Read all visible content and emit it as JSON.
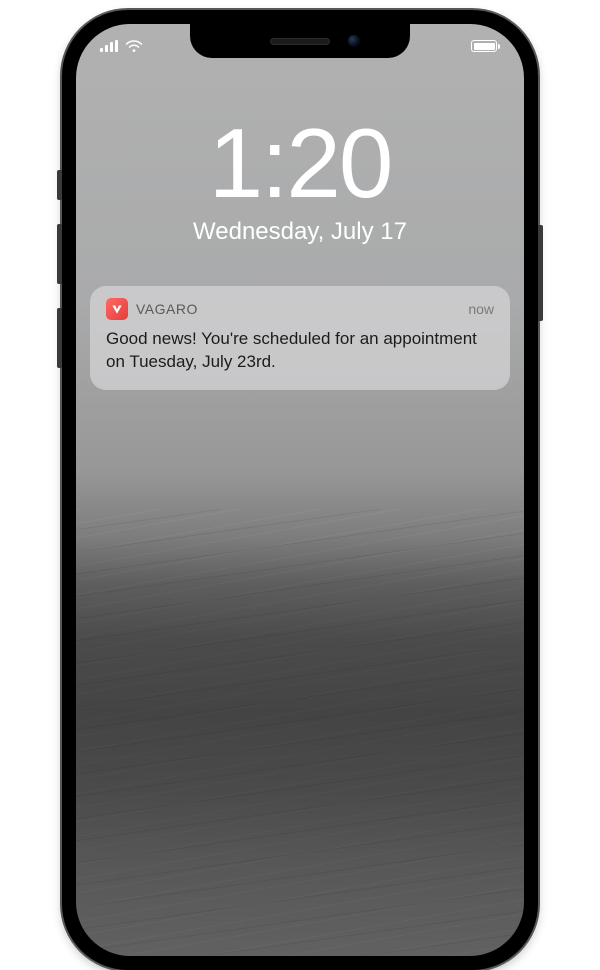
{
  "lockscreen": {
    "time": "1:20",
    "date": "Wednesday, July 17"
  },
  "notification": {
    "app_name": "VAGARO",
    "timestamp": "now",
    "message": "Good news! You're scheduled for an appointment on Tuesday, July 23rd."
  }
}
